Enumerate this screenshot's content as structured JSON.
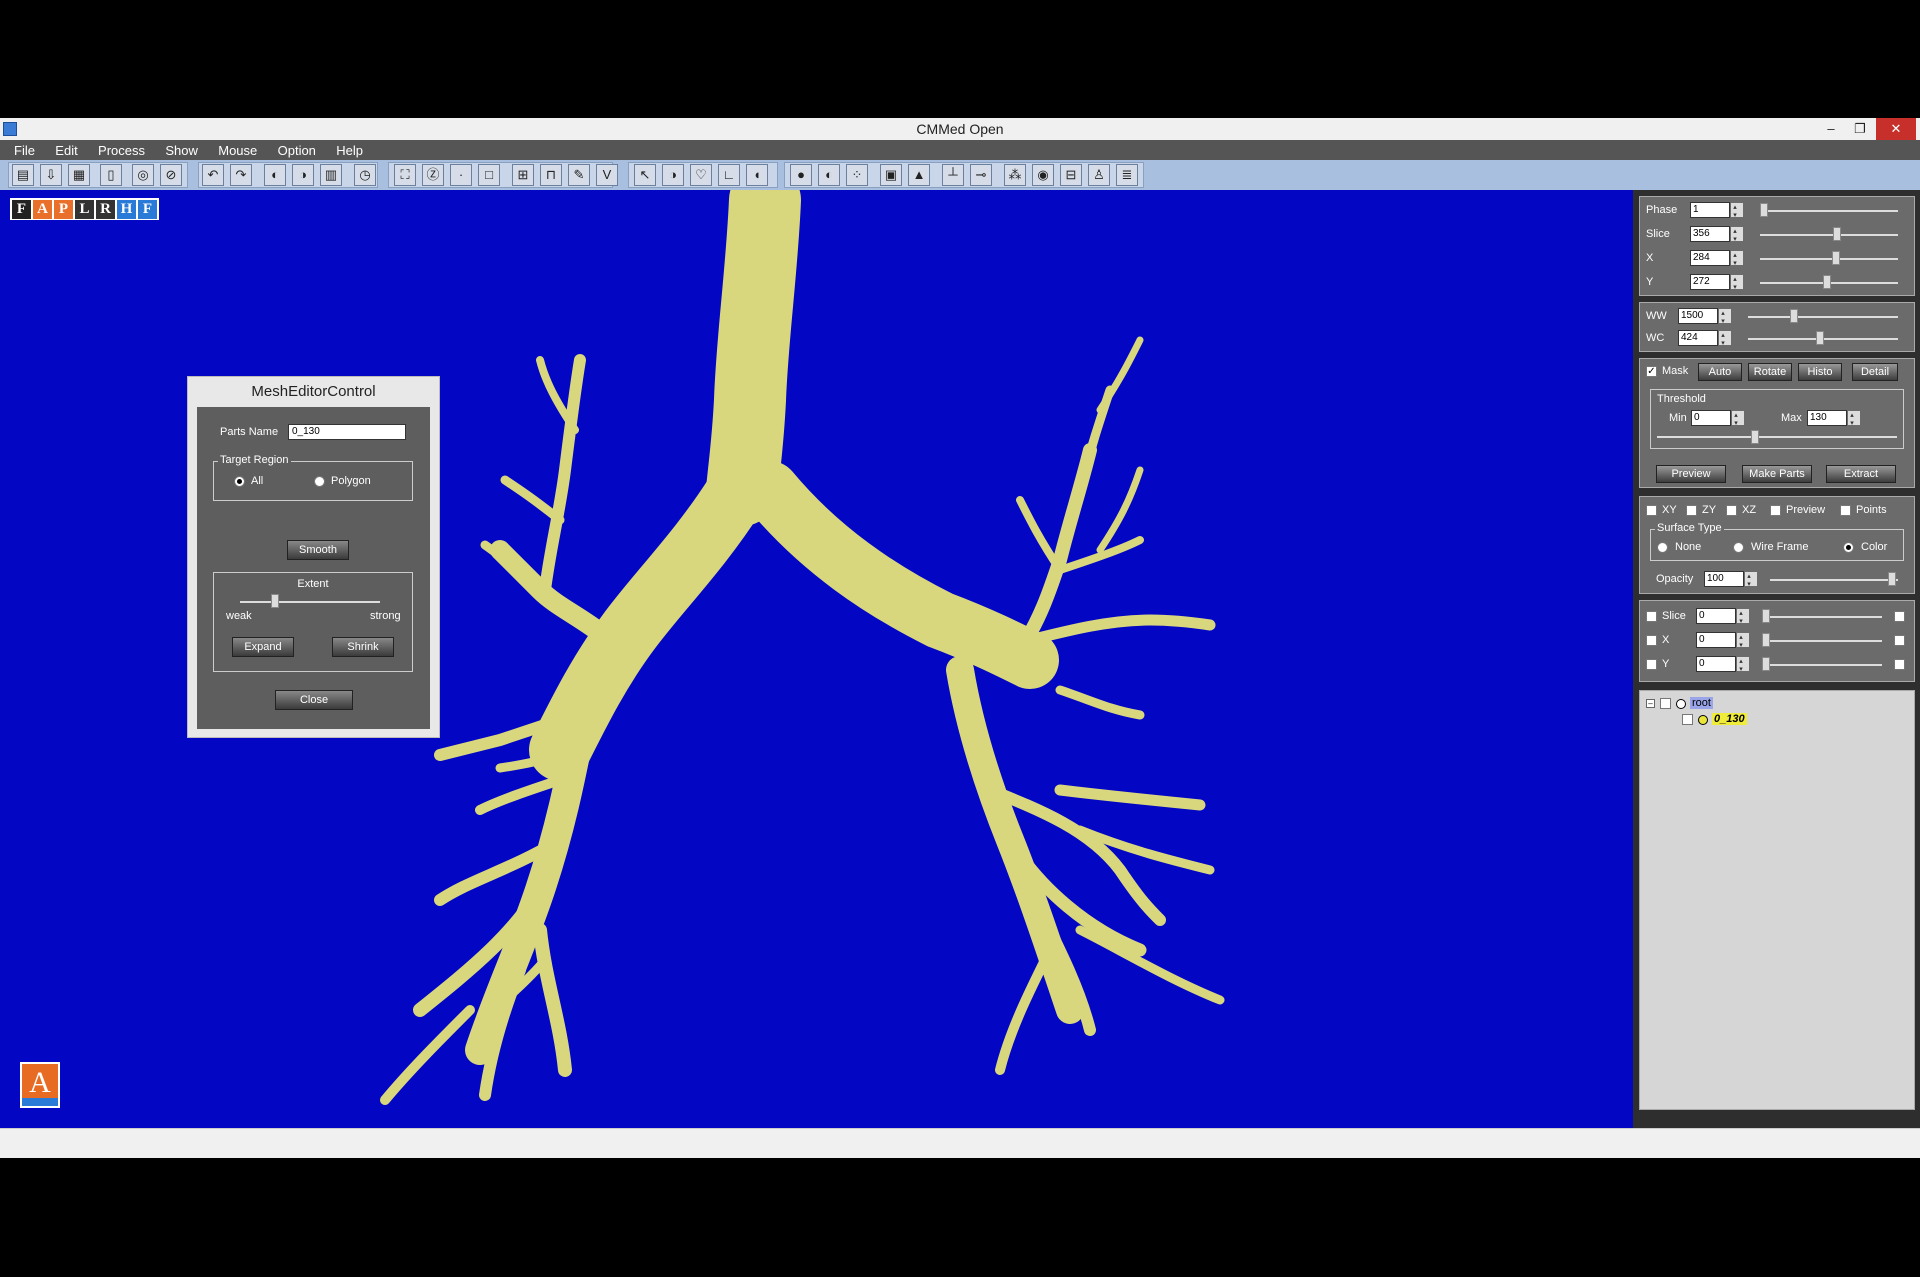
{
  "window": {
    "title": "CMMed  Open",
    "minimize": "–",
    "restore": "❐",
    "close": "✕"
  },
  "menu": [
    "File",
    "Edit",
    "Process",
    "Show",
    "Mouse",
    "Option",
    "Help"
  ],
  "orientation_buttons": [
    {
      "label": "F",
      "color": "#222222"
    },
    {
      "label": "A",
      "color": "#e8702a"
    },
    {
      "label": "P",
      "color": "#e8702a"
    },
    {
      "label": "L",
      "color": "#333333"
    },
    {
      "label": "R",
      "color": "#333333"
    },
    {
      "label": "H",
      "color": "#2a7ad8"
    },
    {
      "label": "F",
      "color": "#2a7ad8"
    }
  ],
  "corner_badge": "A",
  "mesh_editor": {
    "title": "MeshEditorControl",
    "parts_name_label": "Parts Name",
    "parts_name_value": "0_130",
    "target_region_label": "Target Region",
    "radio_all": "All",
    "radio_polygon": "Polygon",
    "smooth_button": "Smooth",
    "extent_label": "Extent",
    "weak_label": "weak",
    "strong_label": "strong",
    "expand_button": "Expand",
    "shrink_button": "Shrink",
    "close_button": "Close",
    "extent_value": 0.25
  },
  "panel": {
    "phase_label": "Phase",
    "phase_value": "1",
    "slice_label": "Slice",
    "slice_value": "356",
    "x_label": "X",
    "x_value": "284",
    "y_label": "Y",
    "y_value": "272",
    "ww_label": "WW",
    "ww_value": "1500",
    "wc_label": "WC",
    "wc_value": "424",
    "mask_label": "Mask",
    "auto_button": "Auto",
    "rotate_button": "Rotate",
    "histo_button": "Histo",
    "detail_button": "Detail",
    "threshold_label": "Threshold",
    "min_label": "Min",
    "min_value": "0",
    "max_label": "Max",
    "max_value": "130",
    "preview_button": "Preview",
    "make_parts_button": "Make Parts",
    "extract_button": "Extract",
    "xy_label": "XY",
    "zy_label": "ZY",
    "xz_label": "XZ",
    "preview_label": "Preview",
    "points_label": "Points",
    "surface_type_label": "Surface Type",
    "surface_none": "None",
    "surface_wire": "Wire Frame",
    "surface_color": "Color",
    "opacity_label": "Opacity",
    "opacity_value": "100",
    "slice2_label": "Slice",
    "slice2_value": "0",
    "x2_label": "X",
    "x2_value": "0",
    "y2_label": "Y",
    "y2_value": "0"
  },
  "tree": {
    "root": "root",
    "child": "0_130"
  },
  "colors": {
    "viewport": "#0306c3",
    "mesh": "#d8d77e"
  }
}
